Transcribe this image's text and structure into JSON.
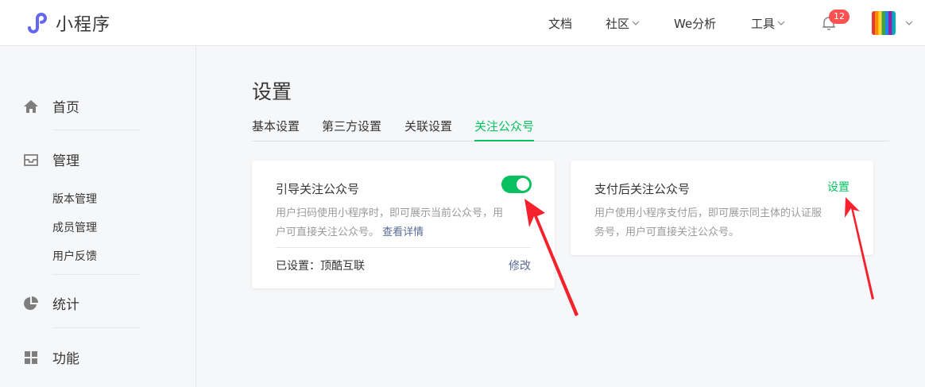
{
  "header": {
    "logo_text": "小程序",
    "nav": [
      {
        "label": "文档",
        "has_dropdown": false
      },
      {
        "label": "社区",
        "has_dropdown": true
      },
      {
        "label": "We分析",
        "has_dropdown": false
      },
      {
        "label": "工具",
        "has_dropdown": true
      }
    ],
    "notification_count": "12",
    "icons": {
      "bell": "bell-icon",
      "avatar": "avatar",
      "dropdown": "chevron-down-icon"
    }
  },
  "sidebar": {
    "items": [
      {
        "label": "首页",
        "icon": "home-icon"
      },
      {
        "label": "管理",
        "icon": "inbox-icon"
      },
      {
        "label": "统计",
        "icon": "pie-chart-icon"
      },
      {
        "label": "功能",
        "icon": "grid-icon"
      }
    ],
    "manage_sub": [
      "版本管理",
      "成员管理",
      "用户反馈"
    ]
  },
  "main": {
    "title": "设置",
    "tabs": [
      {
        "label": "基本设置",
        "active": false
      },
      {
        "label": "第三方设置",
        "active": false
      },
      {
        "label": "关联设置",
        "active": false
      },
      {
        "label": "关注公众号",
        "active": true
      }
    ],
    "card_guide": {
      "title": "引导关注公众号",
      "toggle_on": true,
      "desc_line1": "用户扫码使用小程序时，即可展示当前公众号，用",
      "desc_line2": "户可直接关注公众号。",
      "detail_link": "查看详情",
      "status_label": "已设置：顶酷互联",
      "edit_link": "修改"
    },
    "card_pay": {
      "title": "支付后关注公众号",
      "set_link": "设置",
      "desc_line1": "用户使用小程序支付后，即可展示同主体的认证服",
      "desc_line2": "务号，用户可直接关注公众号。"
    }
  },
  "colors": {
    "accent": "#07c160",
    "link": "#576b95",
    "badge": "#fa5151",
    "annotation_arrow": "#f5222d"
  }
}
